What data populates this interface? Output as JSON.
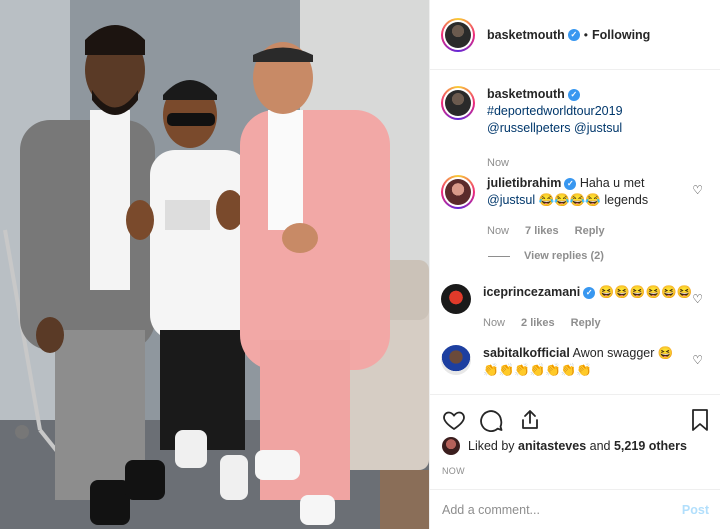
{
  "header": {
    "username": "basketmouth",
    "separator": "•",
    "follow_status": "Following"
  },
  "caption": {
    "username": "basketmouth",
    "hashtag": "#deportedworldtour2019",
    "mention1": "@russellpeters",
    "mention2": "@justsul",
    "time": "Now"
  },
  "comments": [
    {
      "username": "julietibrahim",
      "text_mention": "@justsul",
      "text_before": "Haha u met",
      "text_after": "😂😂😂😂 legends",
      "time": "Now",
      "likes": "7 likes",
      "reply": "Reply",
      "view_replies": "View replies (2)"
    },
    {
      "username": "iceprincezamani",
      "text": "😆😆😆😆😆😆",
      "time": "Now",
      "likes": "2 likes",
      "reply": "Reply"
    },
    {
      "username": "sabitalkofficial",
      "text": "Awon swagger 😆",
      "text2": "👏👏👏👏👏👏👏"
    }
  ],
  "likes": {
    "prefix": "Liked by",
    "user": "anitasteves",
    "middle": "and",
    "count": "5,219 others"
  },
  "timestamp": "NOW",
  "add_comment": {
    "placeholder": "Add a comment...",
    "post_label": "Post"
  },
  "colors": {
    "link": "#00376b",
    "verified": "#3897f0",
    "muted": "#8e8e8e",
    "post_disabled": "#b2dffc"
  }
}
